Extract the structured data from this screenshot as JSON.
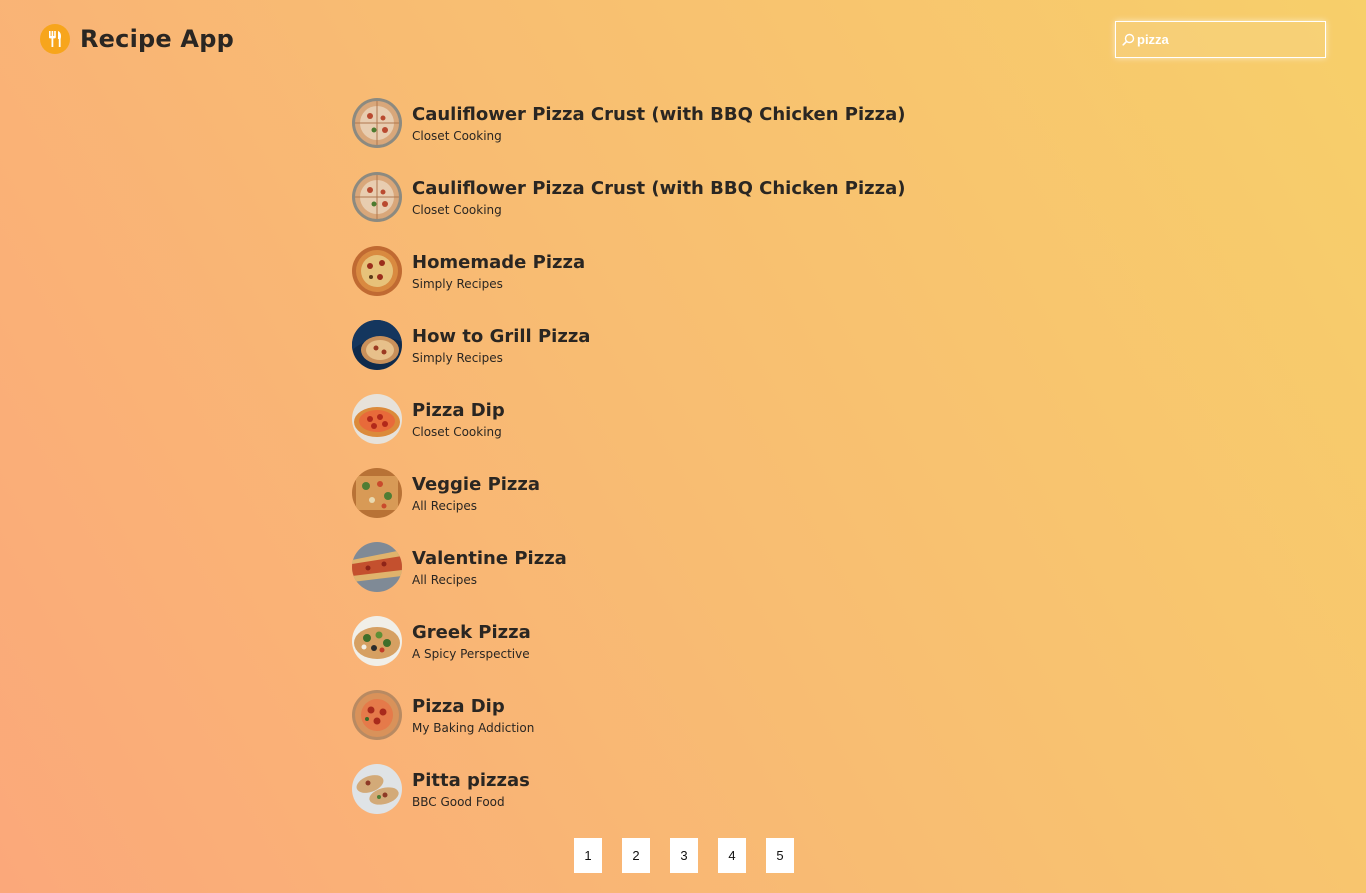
{
  "app": {
    "title": "Recipe App",
    "logo_icon": "fork-knife-icon"
  },
  "search": {
    "value": "pizza",
    "icon": "search-icon"
  },
  "colors": {
    "background_start": "#fba87a",
    "background_end": "#f7cf6a",
    "logo_accent": "#f7a51c",
    "text": "#2a2622"
  },
  "results": [
    {
      "title": "Cauliflower Pizza Crust (with BBQ Chicken Pizza)",
      "publisher": "Closet Cooking"
    },
    {
      "title": "Cauliflower Pizza Crust (with BBQ Chicken Pizza)",
      "publisher": "Closet Cooking"
    },
    {
      "title": "Homemade Pizza",
      "publisher": "Simply Recipes"
    },
    {
      "title": "How to Grill Pizza",
      "publisher": "Simply Recipes"
    },
    {
      "title": "Pizza Dip",
      "publisher": "Closet Cooking"
    },
    {
      "title": "Veggie Pizza",
      "publisher": "All Recipes"
    },
    {
      "title": "Valentine Pizza",
      "publisher": "All Recipes"
    },
    {
      "title": "Greek Pizza",
      "publisher": "A Spicy Perspective"
    },
    {
      "title": "Pizza Dip",
      "publisher": "My Baking Addiction"
    },
    {
      "title": "Pitta pizzas",
      "publisher": "BBC Good Food"
    }
  ],
  "pagination": {
    "pages": [
      "1",
      "2",
      "3",
      "4",
      "5"
    ]
  }
}
